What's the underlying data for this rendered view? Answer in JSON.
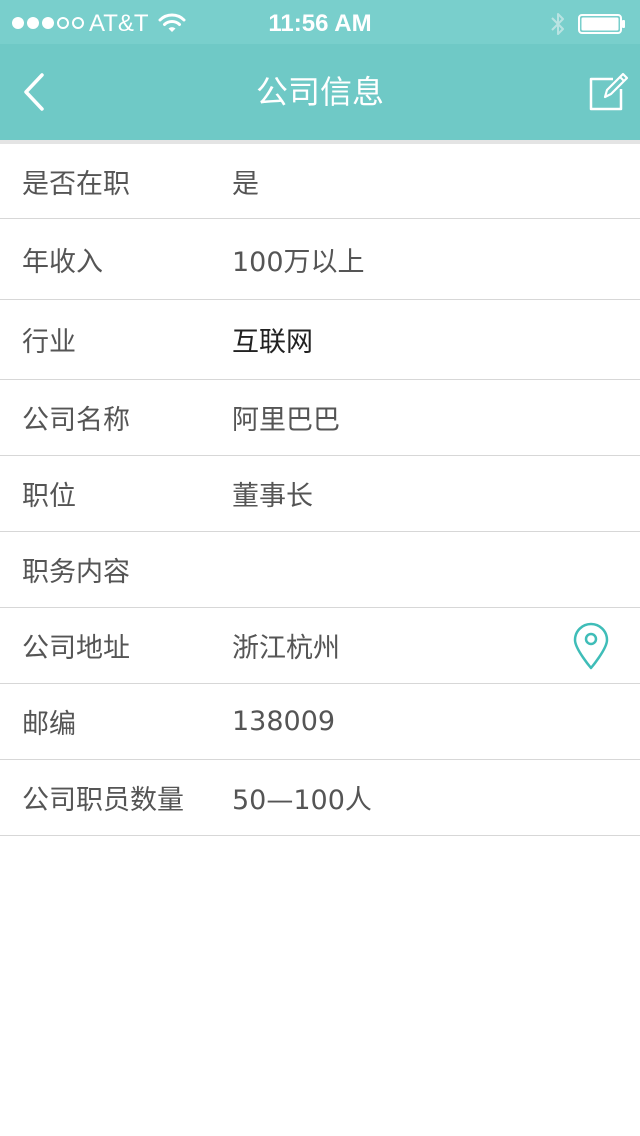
{
  "status_bar": {
    "carrier": "AT&T",
    "time": "11:56 AM",
    "signal_bars_filled": 3,
    "signal_bars_total": 5,
    "wifi_icon": "wifi-icon",
    "bluetooth_icon": "bluetooth-icon",
    "battery_level": 1.0
  },
  "nav": {
    "title": "公司信息",
    "back_icon": "chevron-left-icon",
    "edit_icon": "edit-icon"
  },
  "rows": [
    {
      "label": "是否在职",
      "value": "是"
    },
    {
      "label": "年收入",
      "value": "100万以上"
    },
    {
      "label": "行业",
      "value": "互联网"
    },
    {
      "label": "公司名称",
      "value": "阿里巴巴"
    },
    {
      "label": "职位",
      "value": "董事长"
    },
    {
      "label": "职务内容",
      "value": ""
    },
    {
      "label": "公司地址",
      "value": "浙江杭州",
      "icon": "location-pin-icon"
    },
    {
      "label": "邮编",
      "value": "138009"
    },
    {
      "label": "公司职员数量",
      "value": "50—100人"
    }
  ],
  "colors": {
    "header": "#6fc9c6",
    "status_bar": "#79cfcc",
    "accent": "#3fbdb8",
    "divider": "#d7d7d7",
    "text": "#555555"
  }
}
